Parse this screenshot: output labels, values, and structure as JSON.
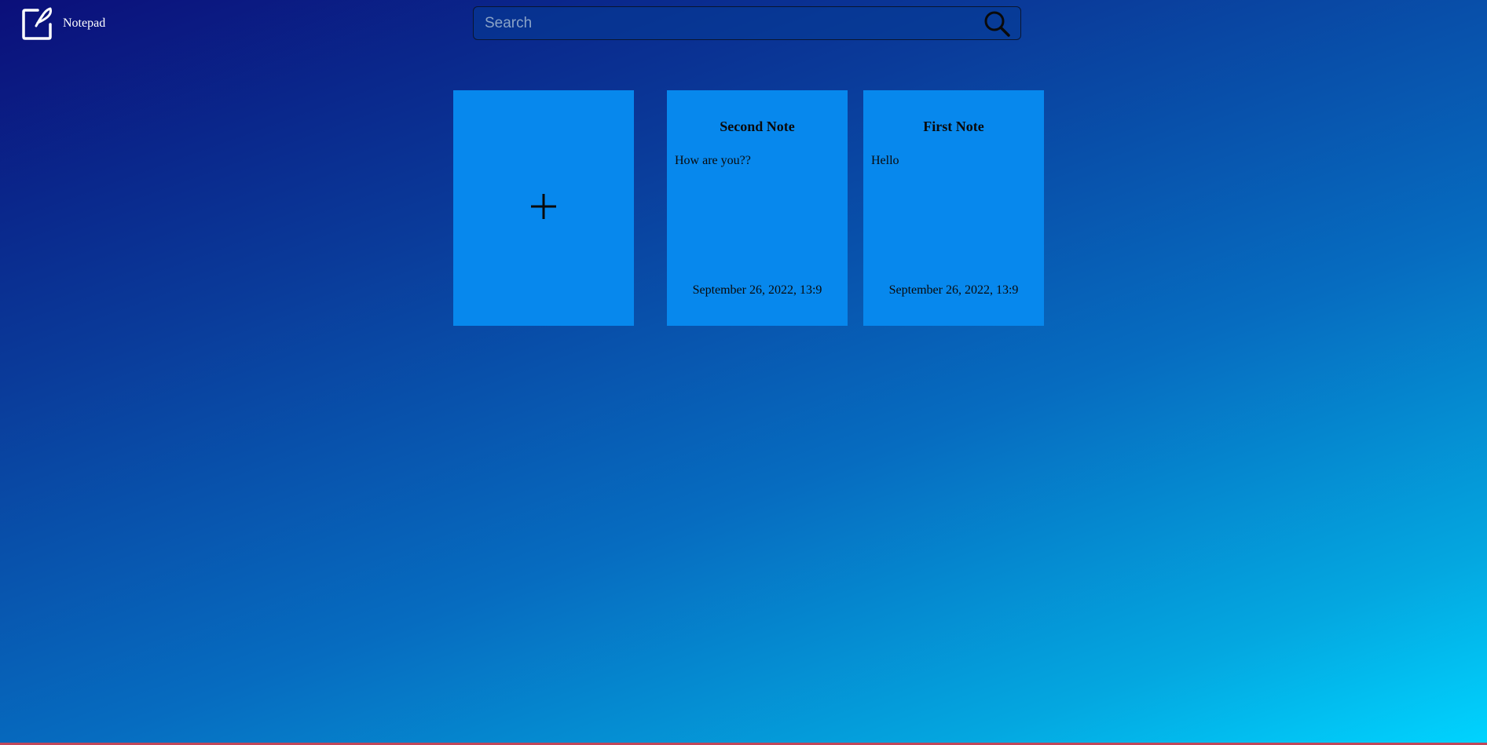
{
  "header": {
    "app_title": "Notepad",
    "logo_icon": "note-edit-icon"
  },
  "search": {
    "placeholder": "Search",
    "value": "",
    "icon": "search-icon"
  },
  "add_card": {
    "icon": "plus-icon"
  },
  "notes": [
    {
      "title": "Second Note",
      "body": "How are you??",
      "date": "September 26, 2022, 13:9"
    },
    {
      "title": "First Note",
      "body": "Hello",
      "date": "September 26, 2022, 13:9"
    }
  ],
  "colors": {
    "card_background": "#0788ed",
    "bottom_bar": "#c0485a",
    "gradient_start": "#0b0f7a",
    "gradient_end": "#00d4ff"
  }
}
